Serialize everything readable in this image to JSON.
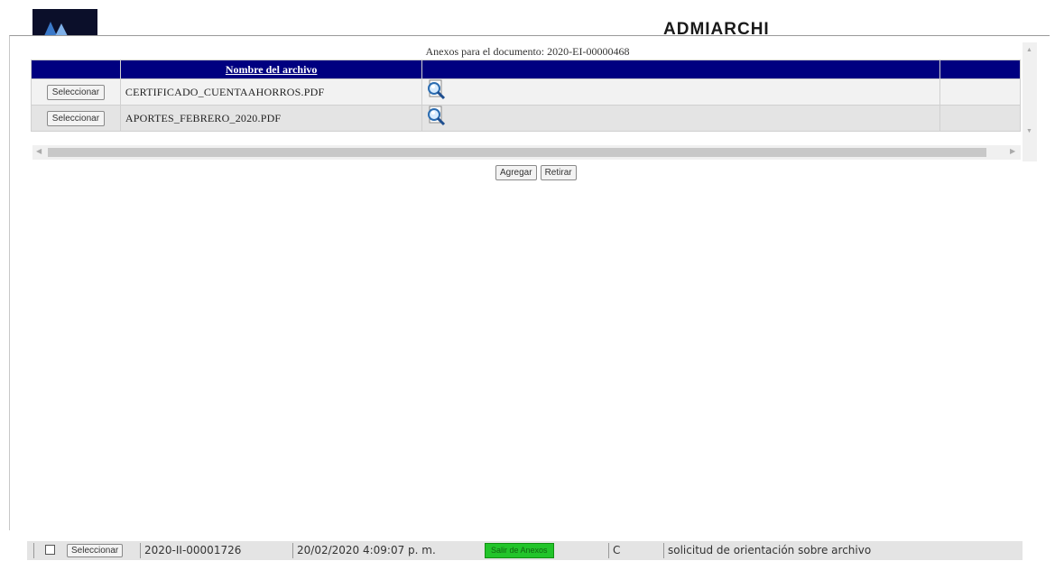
{
  "app": {
    "title": "ADMIARCHI"
  },
  "panel": {
    "caption": "Anexos para el documento: 2020-EI-00000468",
    "column_header": "Nombre del archivo",
    "rows": [
      {
        "button": "Seleccionar",
        "filename": "CERTIFICADO_CUENTAAHORROS.PDF",
        "icon": "magnifier-document-icon"
      },
      {
        "button": "Seleccionar",
        "filename": "APORTES_FEBRERO_2020.PDF",
        "icon": "magnifier-document-icon"
      }
    ],
    "add_label": "Agregar",
    "remove_label": "Retirar"
  },
  "status": {
    "select_label": "Seleccionar",
    "doc_id": "2020-II-00001726",
    "datetime": "20/02/2020 4:09:07 p. m.",
    "exit_label": "Salir de Anexos",
    "code": "C",
    "subject": "solicitud de orientación sobre archivo"
  },
  "colors": {
    "header": "#000080",
    "exit_button": "#22c42a"
  }
}
